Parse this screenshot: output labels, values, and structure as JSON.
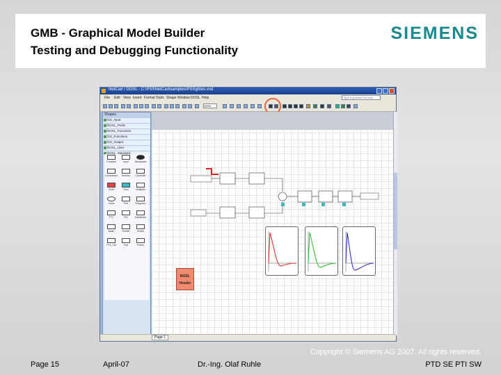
{
  "slide": {
    "title_line1": "GMB - Graphical Model Builder",
    "title_line2": "Testing and Debugging Functionality",
    "logo": "SIEMENS"
  },
  "app": {
    "window_title": "NetCad / DOSL - C:\\PSSNetCad\\samples\\PSSgt\\tes.vsd",
    "menu": [
      "File",
      "Edit",
      "View",
      "Insert",
      "Format",
      "Tools",
      "Shape",
      "Window",
      "DOSL",
      "Help"
    ],
    "help_placeholder": "Type a question for help",
    "zoom": "100%",
    "shapes_header": "Shapes",
    "stencils": [
      "Gtz_Input",
      "DOSL_Prefix",
      "DOSL_Functions",
      "Gtz_Functions",
      "Gtz_Output",
      "DOSL_User",
      "DOSL_Standard"
    ],
    "palette_items": [
      "Constant",
      "Input",
      "Breakpoint",
      "Comparator",
      "Selector",
      "Controller",
      "GAIN",
      "Sum",
      "Multiplier",
      "Clock",
      "Plot",
      "Integrator",
      "PT1",
      "PID",
      "Deadband",
      "Adder",
      "Divider",
      "Limiter",
      "PT1_Ctrl",
      "Plot",
      "Power"
    ],
    "page_tab": "Page-1",
    "bosl_block": [
      "BOSL",
      "Header"
    ]
  },
  "footer": {
    "page": "Page 15",
    "date": "April-07",
    "author": "Dr.-Ing. Olaf Ruhle",
    "copyright": "Copyright © Siemens AG 2007. All rights reserved.",
    "dept": "PTD SE PTI SW"
  },
  "colors": {
    "siemens_teal": "#1a8a8e",
    "highlight_circle": "#e8633a",
    "plot_red": "#d22",
    "plot_green": "#2b2",
    "plot_blue": "#22c"
  }
}
